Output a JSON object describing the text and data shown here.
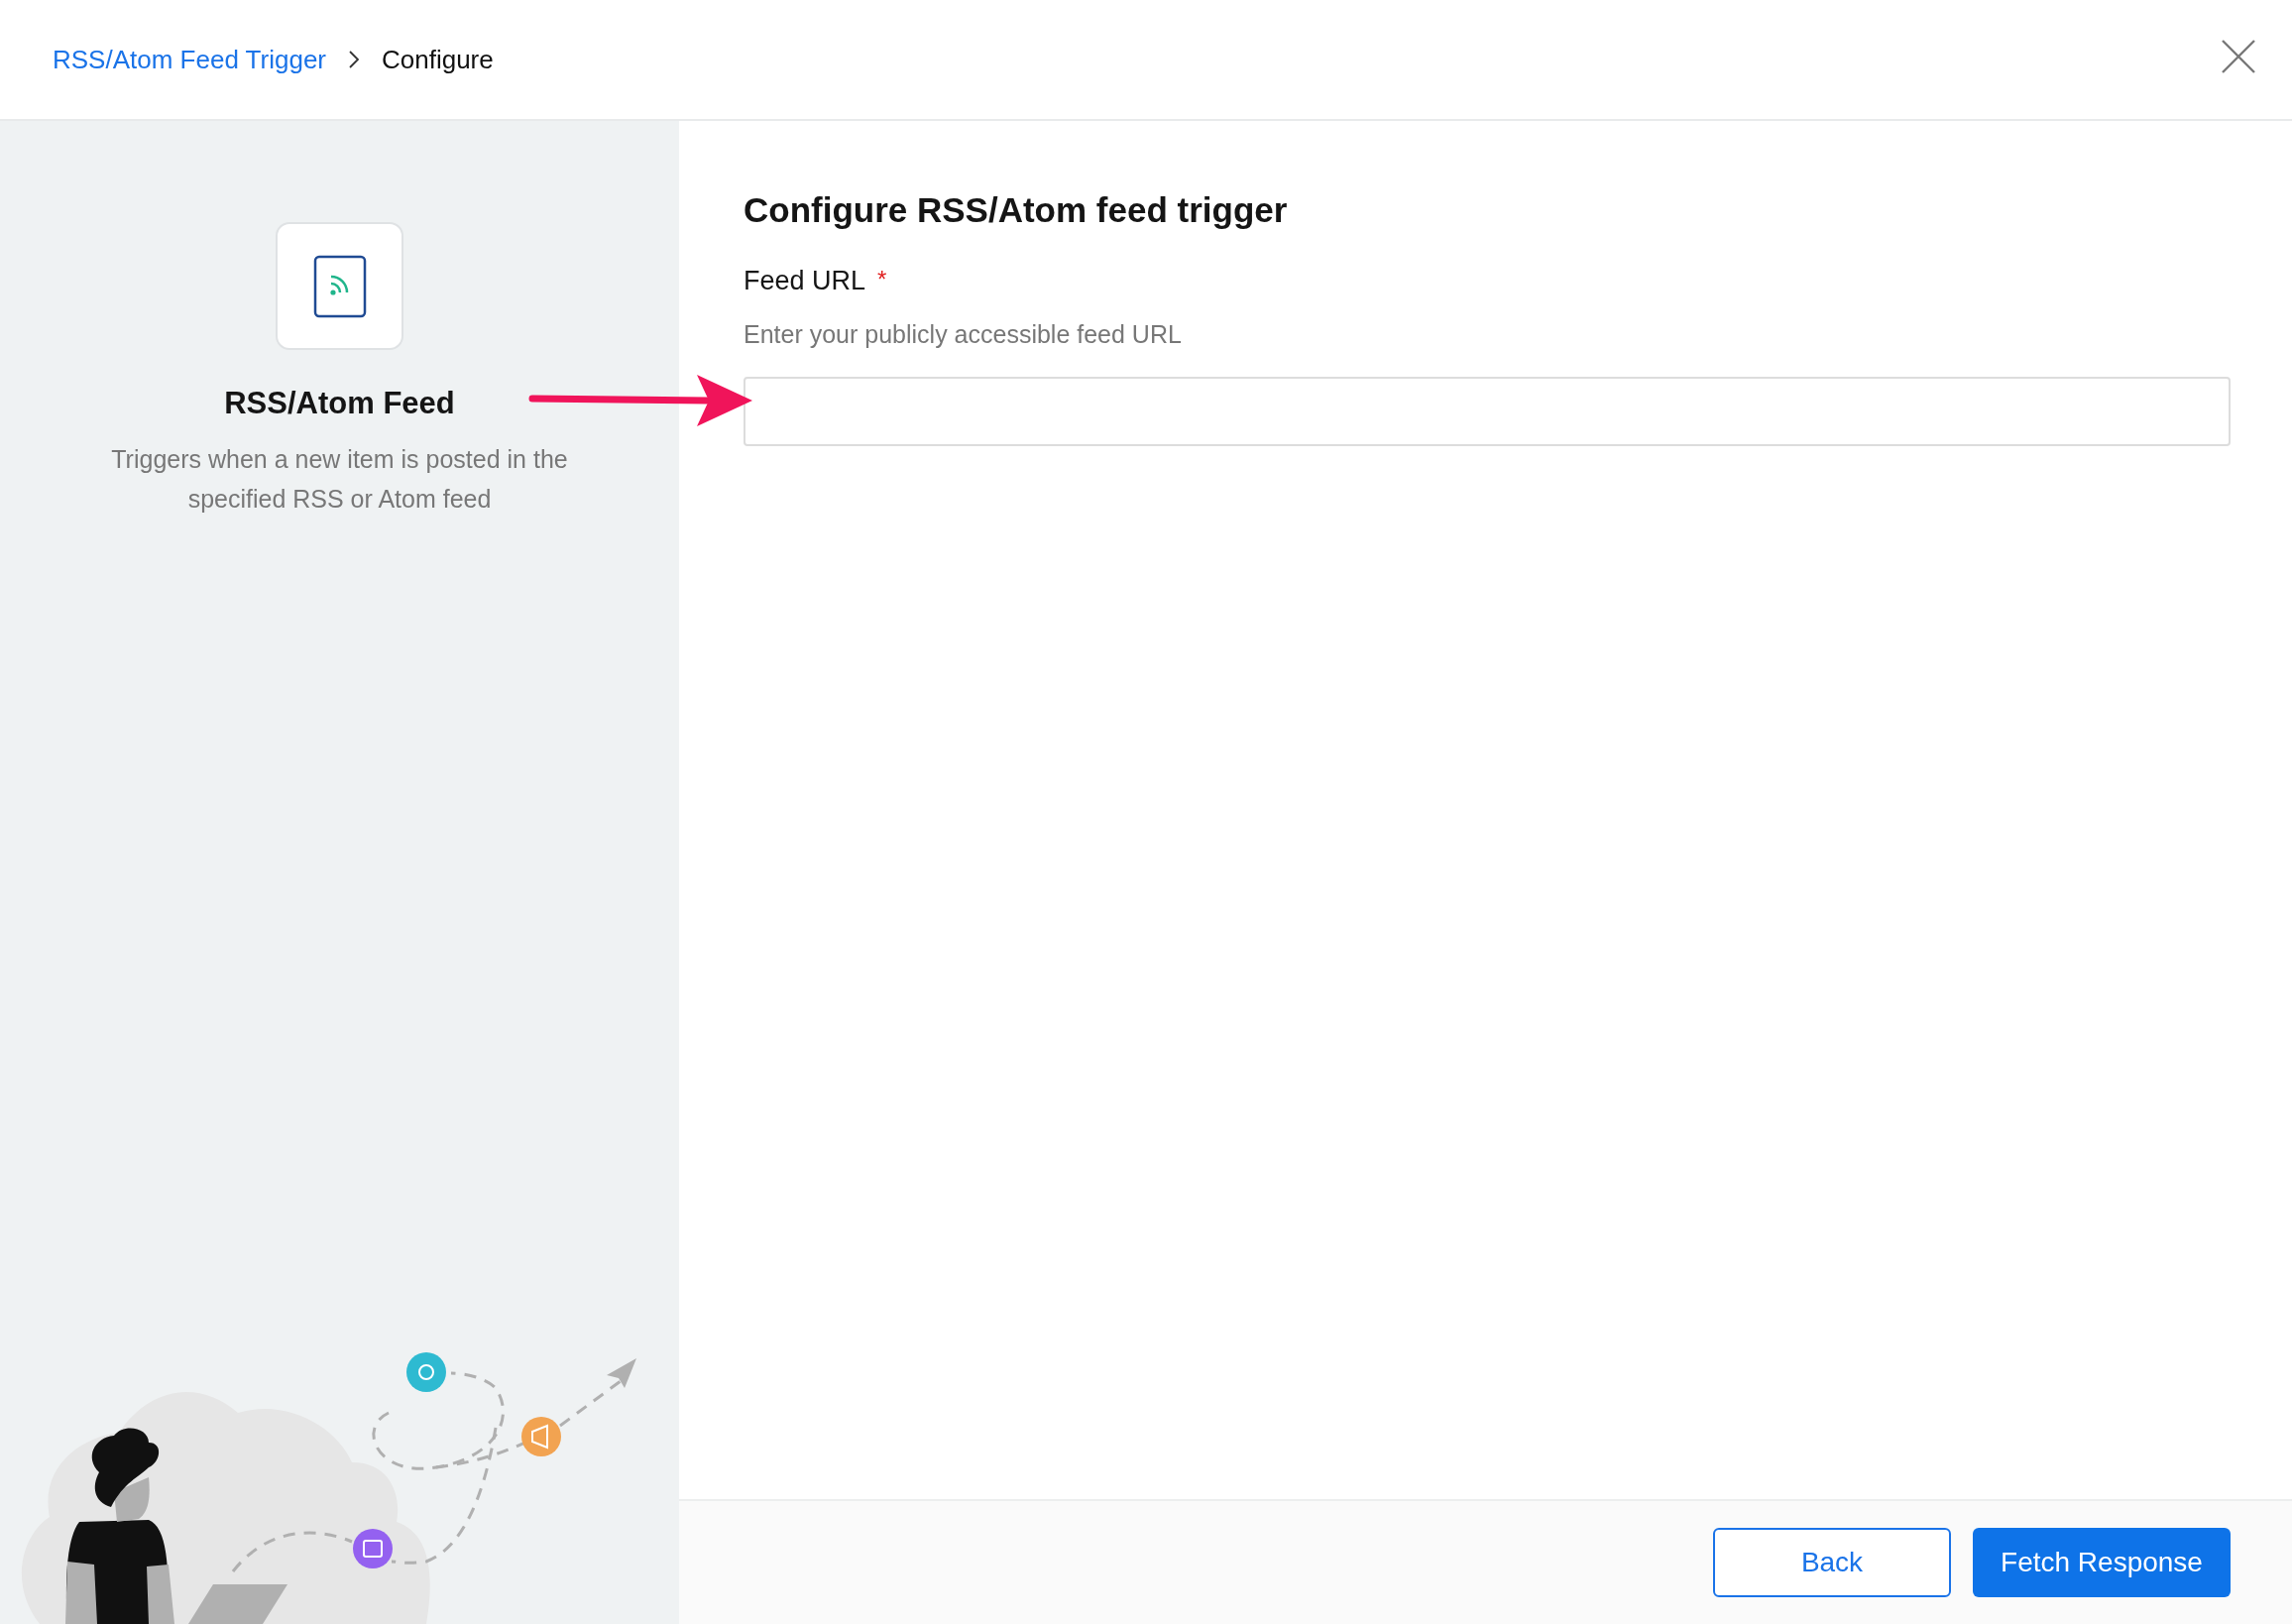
{
  "breadcrumb": [
    {
      "label": "RSS/Atom Feed Trigger",
      "kind": "link"
    },
    {
      "label": "Configure",
      "kind": "current"
    }
  ],
  "app_panel": {
    "name": "RSS/Atom Feed",
    "description": "Triggers when a new item is posted in the specified RSS or Atom feed"
  },
  "form": {
    "title": "Configure RSS/Atom feed trigger",
    "field": {
      "label": "Feed URL",
      "required_mark": "*",
      "hint": "Enter your publicly accessible feed URL"
    }
  },
  "buttons": [
    {
      "label": "Back",
      "kind": "secondary"
    },
    {
      "label": "Fetch Response",
      "kind": "primary"
    }
  ]
}
